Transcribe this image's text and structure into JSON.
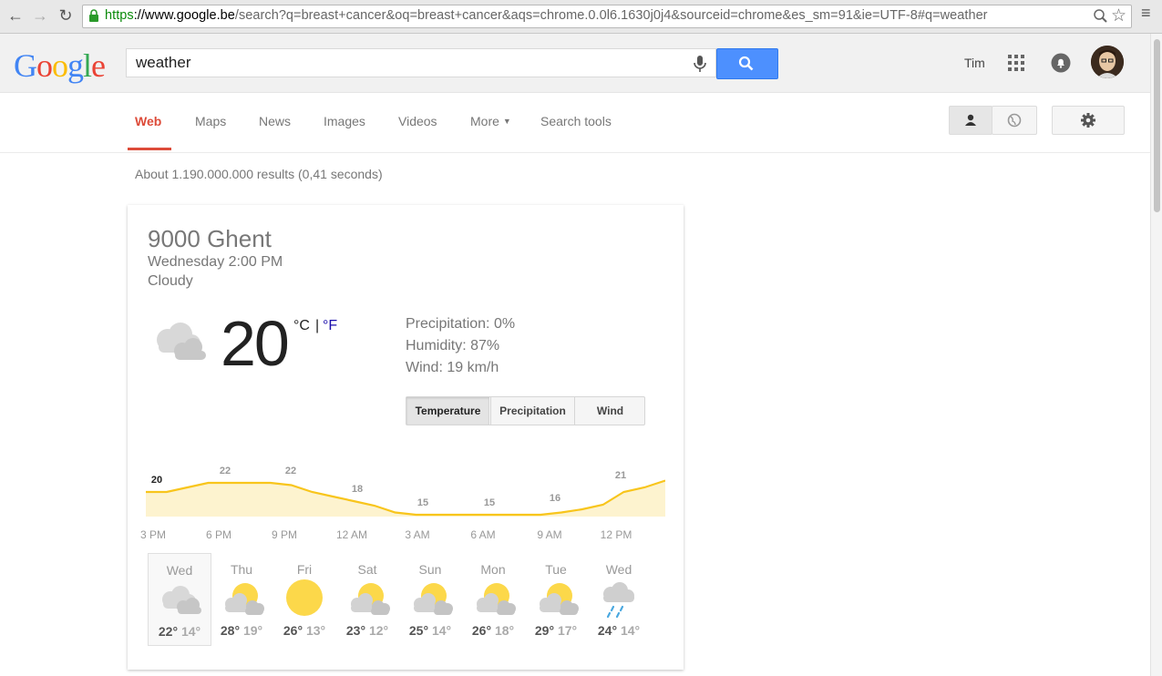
{
  "browser": {
    "url_scheme": "https",
    "url_host": "://www.google.be",
    "url_rest": "/search?q=breast+cancer&oq=breast+cancer&aqs=chrome.0.0l6.1630j0j4&sourceid=chrome&es_sm=91&ie=UTF-8#q=weather",
    "back_icon": "back-arrow-icon",
    "forward_icon": "forward-arrow-icon",
    "reload_icon": "reload-icon"
  },
  "header": {
    "logo": "Google",
    "search_query": "weather",
    "user_name": "Tim"
  },
  "nav": {
    "tabs": [
      {
        "label": "Web",
        "active": true
      },
      {
        "label": "Maps"
      },
      {
        "label": "News"
      },
      {
        "label": "Images"
      },
      {
        "label": "Videos"
      },
      {
        "label": "More"
      },
      {
        "label": "Search tools"
      }
    ]
  },
  "results": {
    "stats": "About 1.190.000.000 results (0,41 seconds)"
  },
  "weather": {
    "location": "9000 Ghent",
    "datetime": "Wednesday 2:00 PM",
    "condition": "Cloudy",
    "temperature": "20",
    "unit_c": "°C",
    "unit_sep": "|",
    "unit_f": "°F",
    "precipitation": "Precipitation: 0%",
    "humidity": "Humidity: 87%",
    "wind": "Wind: 19 km/h",
    "tabs": [
      "Temperature",
      "Precipitation",
      "Wind"
    ],
    "selected_tab": "Temperature",
    "times": [
      "3 PM",
      "6 PM",
      "9 PM",
      "12 AM",
      "3 AM",
      "6 AM",
      "9 AM",
      "12 PM"
    ],
    "days": [
      {
        "name": "Wed",
        "hi": "22°",
        "lo": "14°",
        "icon": "cloudy-icon",
        "selected": true
      },
      {
        "name": "Thu",
        "hi": "28°",
        "lo": "19°",
        "icon": "partly-cloudy-icon"
      },
      {
        "name": "Fri",
        "hi": "26°",
        "lo": "13°",
        "icon": "sunny-icon"
      },
      {
        "name": "Sat",
        "hi": "23°",
        "lo": "12°",
        "icon": "partly-cloudy-icon"
      },
      {
        "name": "Sun",
        "hi": "25°",
        "lo": "14°",
        "icon": "partly-cloudy-icon"
      },
      {
        "name": "Mon",
        "hi": "26°",
        "lo": "18°",
        "icon": "partly-cloudy-icon"
      },
      {
        "name": "Tue",
        "hi": "29°",
        "lo": "17°",
        "icon": "partly-cloudy-icon"
      },
      {
        "name": "Wed",
        "hi": "24°",
        "lo": "14°",
        "icon": "rain-icon"
      }
    ]
  },
  "chart_data": {
    "type": "area",
    "x": [
      "3 PM",
      "6 PM",
      "9 PM",
      "12 AM",
      "3 AM",
      "6 AM",
      "9 AM",
      "12 PM"
    ],
    "series": [
      {
        "values": [
          20,
          22,
          22,
          18,
          15,
          15,
          16,
          21
        ]
      }
    ],
    "curve": [
      20,
      20,
      21,
      22,
      22,
      22,
      22,
      21.5,
      20,
      19,
      18,
      17,
      15.5,
      15,
      15,
      15,
      15,
      15,
      15,
      15,
      15.5,
      16.2,
      17.2,
      20,
      21,
      22.5
    ],
    "ylim": [
      12,
      24
    ],
    "colors": {
      "line": "#f8c51c",
      "fill": "#fdf3cf"
    }
  }
}
